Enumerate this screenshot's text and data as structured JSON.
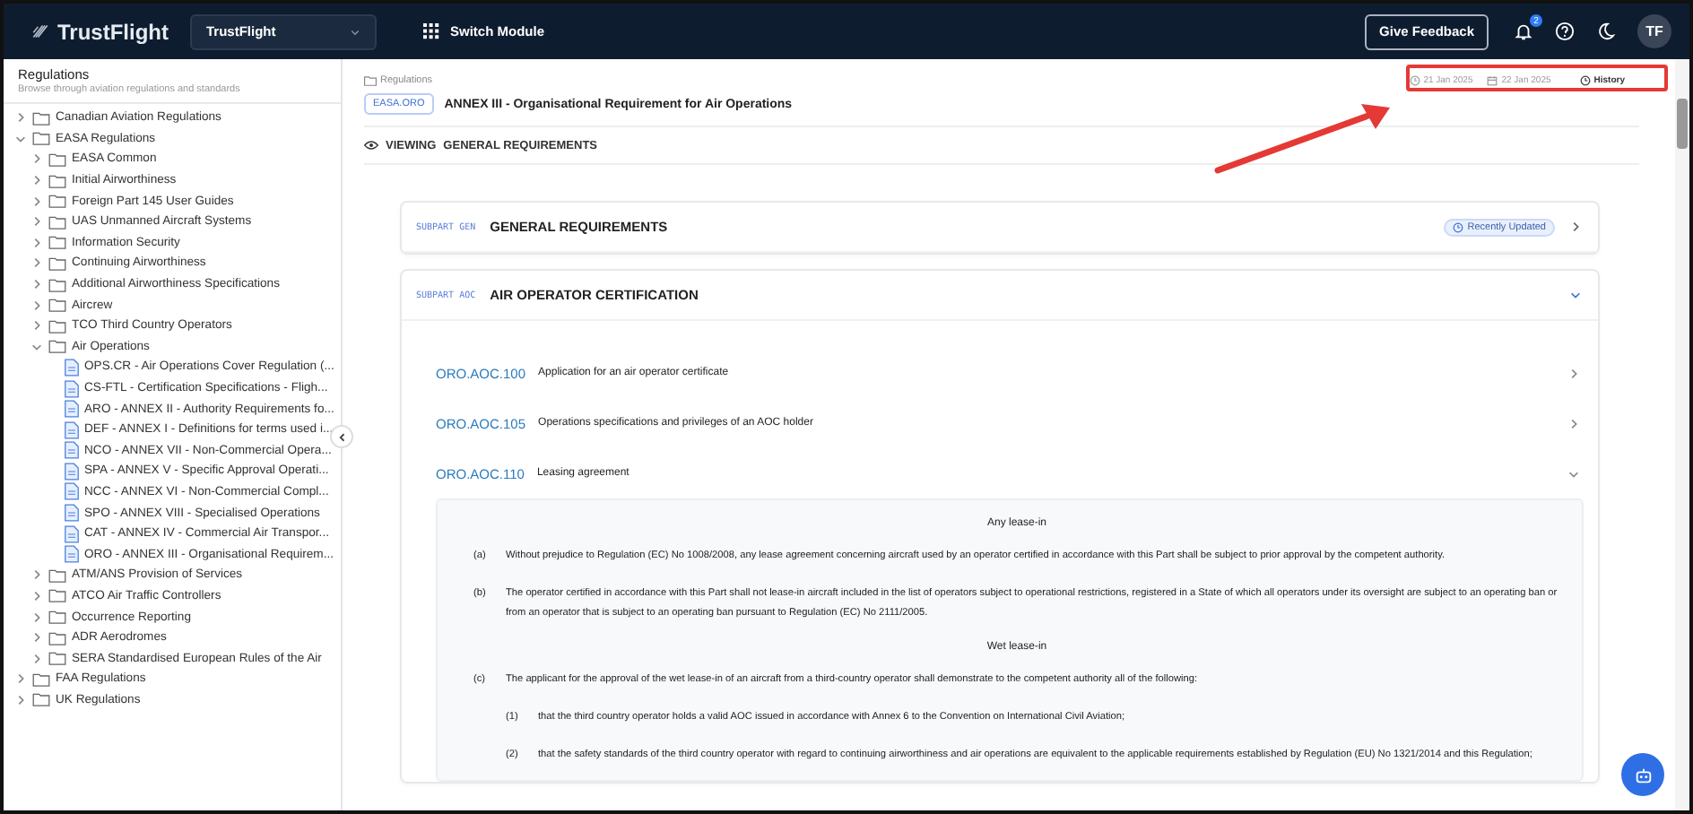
{
  "topbar": {
    "brand": "TrustFlight",
    "org_select": "TrustFlight",
    "switch_module": "Switch Module",
    "feedback": "Give Feedback",
    "notifications": "2",
    "avatar": "TF"
  },
  "sidebar": {
    "title": "Regulations",
    "subtitle": "Browse through aviation regulations and standards",
    "tree": [
      {
        "label": "Canadian Aviation Regulations",
        "kind": "folder",
        "expanded": false
      },
      {
        "label": "EASA Regulations",
        "kind": "folder",
        "expanded": true,
        "children": [
          {
            "label": "EASA Common",
            "kind": "folder",
            "expanded": false
          },
          {
            "label": "Initial Airworthiness",
            "kind": "folder",
            "expanded": false
          },
          {
            "label": "Foreign Part 145 User Guides",
            "kind": "folder",
            "expanded": false
          },
          {
            "label": "UAS Unmanned Aircraft Systems",
            "kind": "folder",
            "expanded": false
          },
          {
            "label": "Information Security",
            "kind": "folder",
            "expanded": false
          },
          {
            "label": "Continuing Airworthiness",
            "kind": "folder",
            "expanded": false
          },
          {
            "label": "Additional Airworthiness Specifications",
            "kind": "folder",
            "expanded": false
          },
          {
            "label": "Aircrew",
            "kind": "folder",
            "expanded": false
          },
          {
            "label": "TCO Third Country Operators",
            "kind": "folder",
            "expanded": false
          },
          {
            "label": "Air Operations",
            "kind": "folder",
            "expanded": true,
            "children": [
              {
                "label": "OPS.CR - Air Operations Cover Regulation (...",
                "kind": "document"
              },
              {
                "label": "CS-FTL - Certification Specifications - Fligh...",
                "kind": "document"
              },
              {
                "label": "ARO - ANNEX II - Authority Requirements fo...",
                "kind": "document"
              },
              {
                "label": "DEF - ANNEX I - Definitions for terms used i...",
                "kind": "document"
              },
              {
                "label": "NCO - ANNEX VII - Non-Commercial Opera...",
                "kind": "document"
              },
              {
                "label": "SPA - ANNEX V - Specific Approval Operati...",
                "kind": "document"
              },
              {
                "label": "NCC - ANNEX VI - Non-Commercial Compl...",
                "kind": "document"
              },
              {
                "label": "SPO - ANNEX VIII - Specialised Operations",
                "kind": "document"
              },
              {
                "label": "CAT - ANNEX IV - Commercial Air Transpor...",
                "kind": "document"
              },
              {
                "label": "ORO - ANNEX III - Organisational Requirem...",
                "kind": "document"
              }
            ]
          },
          {
            "label": "ATM/ANS Provision of Services",
            "kind": "folder",
            "expanded": false
          },
          {
            "label": "ATCO Air Traffic Controllers",
            "kind": "folder",
            "expanded": false
          },
          {
            "label": "Occurrence Reporting",
            "kind": "folder",
            "expanded": false
          },
          {
            "label": "ADR Aerodromes",
            "kind": "folder",
            "expanded": false
          },
          {
            "label": "SERA Standardised European Rules of the Air",
            "kind": "folder",
            "expanded": false
          }
        ]
      },
      {
        "label": "FAA Regulations",
        "kind": "folder",
        "expanded": false
      },
      {
        "label": "UK Regulations",
        "kind": "folder",
        "expanded": false
      }
    ]
  },
  "document": {
    "breadcrumb": "Regulations",
    "code": "EASA.ORO",
    "title": "ANNEX III - Organisational Requirement for Air Operations",
    "created": "21 Jan 2025",
    "updated": "22 Jan 2025",
    "history": "History",
    "viewing_label": "VIEWING",
    "viewing": "GENERAL REQUIREMENTS"
  },
  "subparts": [
    {
      "code": "SUBPART GEN",
      "title": "GENERAL REQUIREMENTS",
      "tag": "Recently Updated",
      "expanded": false
    },
    {
      "code": "SUBPART AOC",
      "title": "AIR OPERATOR CERTIFICATION",
      "expanded": true,
      "rules": [
        {
          "code": "ORO.AOC.100",
          "title": "Application for an air operator certificate",
          "expanded": false
        },
        {
          "code": "ORO.AOC.105",
          "title": "Operations specifications and privileges of an AOC holder",
          "expanded": false
        },
        {
          "code": "ORO.AOC.110",
          "title": "Leasing agreement",
          "expanded": true,
          "blocks": [
            {
              "kind": "heading",
              "text": "Any lease-in"
            },
            {
              "kind": "para",
              "label": "(a)",
              "text": "Without prejudice to Regulation (EC) No 1008/2008, any lease agreement concerning aircraft used by an operator certified in accordance with this Part shall be subject to prior approval by the competent authority."
            },
            {
              "kind": "para",
              "label": "(b)",
              "text": "The operator certified in accordance with this Part shall not lease-in aircraft included in the list of operators subject to operational restrictions, registered in a State of which all operators under its oversight are subject to an operating ban or from an operator that is subject to an operating ban pursuant to Regulation (EC) No 2111/2005."
            },
            {
              "kind": "heading",
              "text": "Wet lease-in"
            },
            {
              "kind": "para",
              "label": "(c)",
              "text": "The applicant for the approval of the wet lease-in of an aircraft from a third-country operator shall demonstrate to the competent authority all of the following:"
            },
            {
              "kind": "subpara",
              "label": "(1)",
              "text": "that the third country operator holds a valid AOC issued in accordance with Annex 6 to the Convention on International Civil Aviation;"
            },
            {
              "kind": "subpara",
              "label": "(2)",
              "text": "that the safety standards of the third country operator with regard to continuing airworthiness and air operations are equivalent to the applicable requirements established by Regulation (EU) No 1321/2014 and this Regulation;"
            }
          ]
        }
      ]
    }
  ]
}
